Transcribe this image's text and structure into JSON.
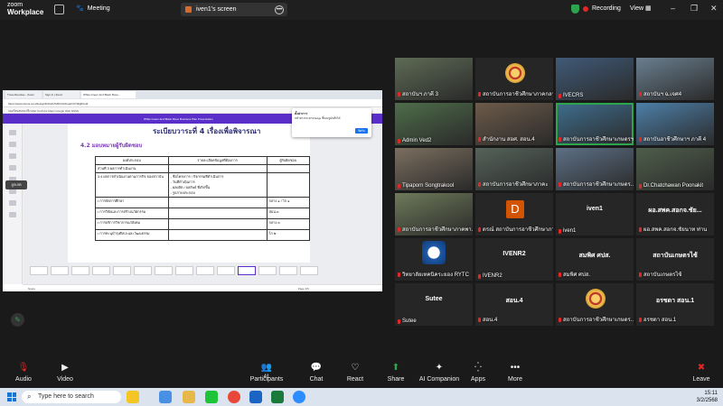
{
  "app": {
    "brand_top": "zoom",
    "brand_bottom": "Workplace"
  },
  "titlebar": {
    "meeting_label": "Meeting",
    "share_pill_label": "iven1's screen",
    "recording_label": "Recording",
    "view_label": "View"
  },
  "shared_screen": {
    "browser_tabs": [
      "Trout Attendee - Zoom",
      "Sign in | Zoom",
      "White Green And Black Bove..."
    ],
    "url": "https://www.canva.com/design/DAGds7kR0m/kbxoaFr0Y0bjjR/edit",
    "bookmarks": "จองเรียนสนทนาที่ง  Mail  YouTube  Maps  Google  Web NSSH",
    "canva_title": "White Green And Black Move Business Plan Presentation",
    "slide_title": "ระเบียบวาระที่ 4 เรื่องเพื่อพิจารณา",
    "slide_subtitle": "4.2 มอบหมายผู้รับผิดชอบ",
    "table": {
      "headers": [
        "องค์ประกอบ",
        "รายละเอียดข้อมูลที่ต้องการ",
        "ผู้รับผิดชอบ"
      ],
      "rows": [
        [
          "ส่วนที่ 3   ผลการดำเนินงาน",
          "",
          ""
        ],
        [
          "3.4  ผลการดำเนินงานตามภารกิจ ของสถาบัน",
          "- ชื่อโครงการ / กิจกรรมที่ดำเนินการ\n- วันที่ดำเนินการ\n- ผลผลิต / ผลลัพธ์ ที่เกิดขึ้น\n- รูปภาพประกอบ",
          ""
        ],
        [
          "• การจัดการศึกษา",
          "",
          "กลาง ๑ / ไก ๑"
        ],
        [
          "• การวิจัยและการสร้างนวัตกรรม",
          "",
          "สอน.๓"
        ],
        [
          "• การบริการวิชาการแก่สังคม",
          "",
          "กลาง ๓"
        ],
        [
          "• การทะนุบำรุงศิลปะและวัฒนธรรม",
          "",
          "ไก ๒"
        ]
      ]
    },
    "popup_title": "ตั้งค่าการ",
    "popup_text": "หน้าต่างกระดาษ Edge ขึ้นเมนูบันทึกได้",
    "popup_button": "ปิดรับ",
    "status_left": "Notes",
    "status_right": "Page 3/5"
  },
  "annotate_chip": "ลูกเกต",
  "participants": [
    {
      "name": "สถาบันฯ ภาคี 3",
      "icon": "video"
    },
    {
      "name": "สถาบันการอาชีวศึกษาภาคกลา...",
      "icon": "seal"
    },
    {
      "name": "IVECRS",
      "icon": "video"
    },
    {
      "name": "สถาบันฯ ฉ.เจศ4",
      "icon": "video"
    },
    {
      "name": "Admin Ved2",
      "icon": "video"
    },
    {
      "name": "สำนักงาน สอศ. สอน.4",
      "icon": "video"
    },
    {
      "name": "สถาบันการอาชีวศึกษาเกษตรฯ 1",
      "icon": "video"
    },
    {
      "name": "สถาบันอาชีวศึกษาฯ ภาคี 4",
      "icon": "video"
    },
    {
      "name": "Tipaporn Songtrakool",
      "icon": "video"
    },
    {
      "name": "สถาบันการอาชีวศึกษาภาคะ",
      "icon": "video"
    },
    {
      "name": "สถาบันการอาชีวศึกษาเกษตร...",
      "icon": "video"
    },
    {
      "name": "Dr.Chatchawan Poonakit",
      "icon": "video"
    },
    {
      "name": "สถาบันการอาชีวศึกษาภาคพา...",
      "icon": "video"
    },
    {
      "name": "ดรณ์ สถาบันการอาชีวศึกษาภา...",
      "icon": "D",
      "title": "D"
    },
    {
      "name": "iven1",
      "icon": "none",
      "title": "iven1"
    },
    {
      "name": "ผอ.สพค.สอกจ.ชัยนาท ท่าน",
      "icon": "none",
      "title": "ผอ.สพค.สอกจ.ชัย..."
    },
    {
      "name": "วิทยาลัยเทคนิคระยอง RYTC",
      "icon": "logo"
    },
    {
      "name": "IVENR2",
      "icon": "none",
      "title": "IVENR2"
    },
    {
      "name": "สมพิศ ศปส.",
      "icon": "none",
      "title": "สมพิศ ศปส."
    },
    {
      "name": "สถาบันเกษตรไซ้",
      "icon": "none",
      "title": "สถาบันเกษตรไซ้"
    },
    {
      "name": "Sutee",
      "icon": "none",
      "title": "Sutee"
    },
    {
      "name": "สอน.4",
      "icon": "none",
      "title": "สอน.4"
    },
    {
      "name": "สถาบันการอาชีวศึกษาเกษตร...",
      "icon": "seal"
    },
    {
      "name": "อรชดา สอน.1",
      "icon": "none",
      "title": "อรชดา สอน.1"
    }
  ],
  "toolbar": {
    "audio": "Audio",
    "video": "Video",
    "participants": "Participants",
    "participants_count": "41",
    "chat": "Chat",
    "react": "React",
    "share": "Share",
    "ai_companion": "AI Companion",
    "apps": "Apps",
    "more": "More",
    "leave": "Leave"
  },
  "taskbar": {
    "search_placeholder": "Type here to search",
    "time": "15:11",
    "date": "3/2/2568"
  }
}
